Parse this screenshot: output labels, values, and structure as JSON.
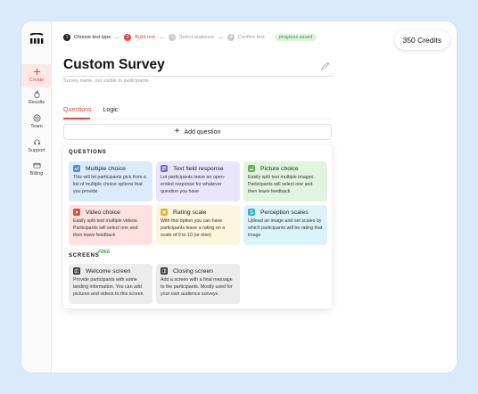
{
  "sidebar": {
    "items": [
      {
        "label": "Create"
      },
      {
        "label": "Results"
      },
      {
        "label": "Team"
      },
      {
        "label": "Support"
      },
      {
        "label": "Billing"
      }
    ]
  },
  "stepper": {
    "steps": [
      {
        "num": "1",
        "label": "Choose test type"
      },
      {
        "num": "2",
        "label": "Build test"
      },
      {
        "num": "3",
        "label": "Select audience"
      },
      {
        "num": "4",
        "label": "Confirm test"
      }
    ],
    "saved": "progress saved"
  },
  "credits": "350 Credits",
  "survey": {
    "title": "Custom Survey",
    "subtitle": "Survey name, not visible to participants"
  },
  "tabs": [
    {
      "label": "Questions"
    },
    {
      "label": "Logic"
    }
  ],
  "add_question": "Add question",
  "questions_section": {
    "label": "QUESTIONS",
    "cards": [
      {
        "title": "Multiple choice",
        "desc": "This will let participants pick from a list of multiple choice options that you provide",
        "color": "#dcebfb",
        "icon_color": "#4a8fe0"
      },
      {
        "title": "Text field response",
        "desc": "Let participants leave an open-ended response for whatever question you have",
        "color": "#e9e6fb",
        "icon_color": "#7b68d8"
      },
      {
        "title": "Picture choice",
        "desc": "Easily split test multiple images. Participants will select one and then leave feedback",
        "color": "#e2f4e0",
        "icon_color": "#5db456"
      },
      {
        "title": "Video choice",
        "desc": "Easily split test multiple videos. Participants will select one and then leave feedback",
        "color": "#fde2e0",
        "icon_color": "#e0493b"
      },
      {
        "title": "Rating scale",
        "desc": "With this option you can have participants leave a rating on a scale of 0 to 10 (or else)",
        "color": "#fdf6df",
        "icon_color": "#e0b62b"
      },
      {
        "title": "Perception scales",
        "desc": "Upload an image and set scales by which participants will be rating that image",
        "color": "#dcf4f7",
        "icon_color": "#2fb3c4"
      }
    ]
  },
  "screens_section": {
    "label": "SCREENS",
    "badge": "FREE",
    "cards": [
      {
        "title": "Welcome screen",
        "desc": "Provide participants with some landing information. You can add pictures and videos to this screen",
        "color": "#ececec",
        "icon_color": "#222222"
      },
      {
        "title": "Closing screen",
        "desc": "Add a screen with a final message to the participants. Mostly used for your own audience surveys",
        "color": "#ececec",
        "icon_color": "#222222"
      }
    ]
  }
}
